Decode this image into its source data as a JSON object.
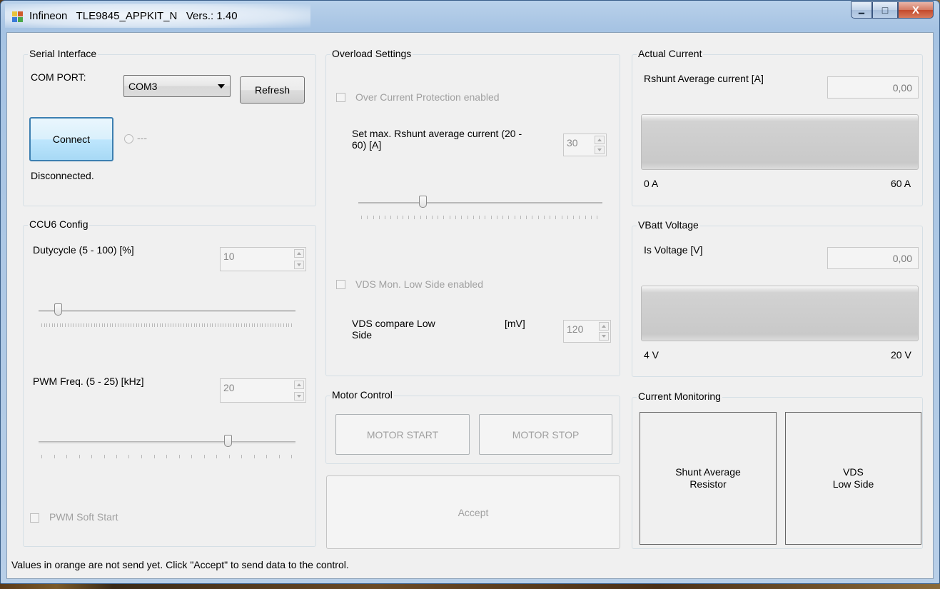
{
  "window": {
    "title": "Infineon   TLE9845_APPKIT_N   Vers.: 1.40",
    "minimize_glyph": "▁",
    "maximize_glyph": "□",
    "close_glyph": "X"
  },
  "serial": {
    "group_title": "Serial Interface",
    "com_port_label": "COM PORT:",
    "com_port_value": "COM3",
    "refresh_label": "Refresh",
    "connect_label": "Connect",
    "indicator_text": "---",
    "status_text": "Disconnected."
  },
  "ccu6": {
    "group_title": "CCU6 Config",
    "duty_label": "Dutycycle (5 - 100) [%]",
    "duty_value": "10",
    "duty_slider": {
      "min": 5,
      "max": 100,
      "value": 10
    },
    "pwm_label": "PWM Freq. (5 - 25) [kHz]",
    "pwm_value": "20",
    "pwm_slider": {
      "min": 5,
      "max": 25,
      "value": 20
    },
    "soft_start_label": "PWM Soft Start"
  },
  "overload": {
    "group_title": "Overload Settings",
    "ocp_label": "Over Current Protection enabled",
    "max_current_label": "Set max. Rshunt average current (20 - 60) [A]",
    "max_current_value": "30",
    "max_current_slider": {
      "min": 20,
      "max": 60,
      "value": 30
    },
    "vds_label": "VDS Mon. Low Side enabled",
    "vds_compare_label": "VDS compare Low Side",
    "vds_unit": "[mV]",
    "vds_value": "120"
  },
  "motor": {
    "group_title": "Motor Control",
    "start_label": "MOTOR START",
    "stop_label": "MOTOR STOP"
  },
  "accept_label": "Accept",
  "actual_current": {
    "group_title": "Actual Current",
    "label": "Rshunt Average current [A]",
    "value": "0,00",
    "min_label": "0 A",
    "max_label": "60 A"
  },
  "vbatt": {
    "group_title": "VBatt Voltage",
    "label": "Is Voltage [V]",
    "value": "0,00",
    "min_label": "4 V",
    "max_label": "20 V"
  },
  "monitoring": {
    "group_title": "Current Monitoring",
    "shunt_line1": "Shunt Average",
    "shunt_line2": "Resistor",
    "vds_line1": "VDS",
    "vds_line2": "Low Side"
  },
  "status_bar": "Values in orange are not send yet. Click \"Accept\" to send data to the control."
}
